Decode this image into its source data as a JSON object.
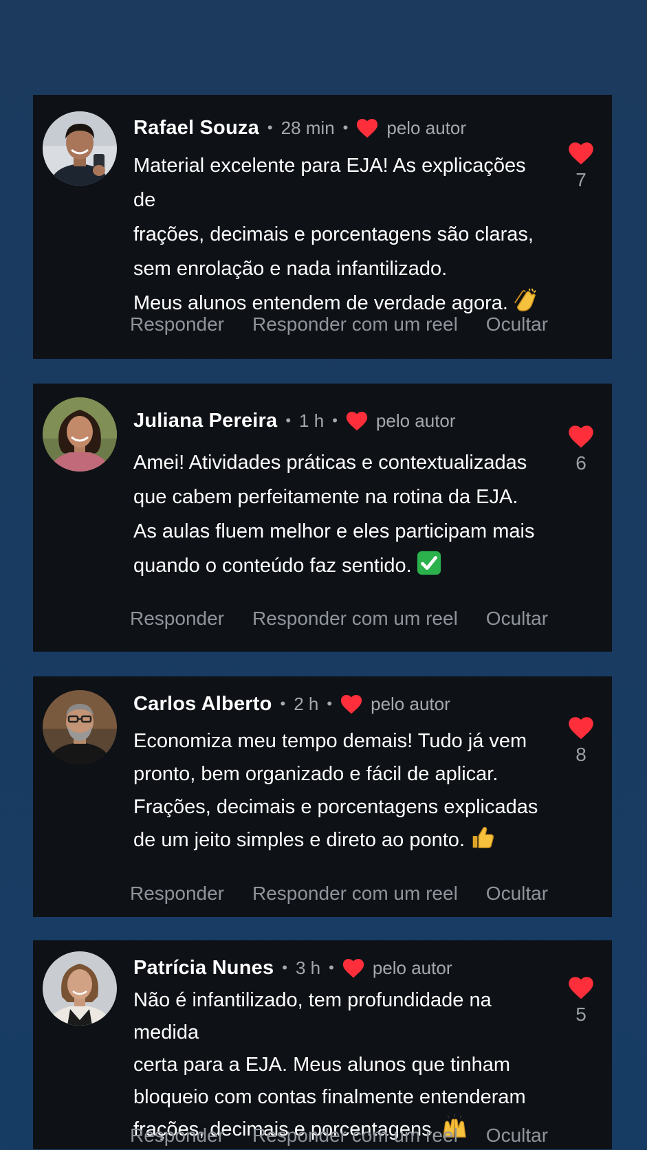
{
  "colors": {
    "background": "#173c64",
    "card": "#0e1116",
    "heart": "#ff2e3b",
    "name": "#ffffff",
    "meta": "#a5a9af",
    "action": "#8f949b"
  },
  "comments": [
    {
      "author": "Rafael Souza",
      "time": "28 min",
      "author_like_label": "pelo autor",
      "lines": [
        "Material excelente para EJA! As explicações de",
        "frações, decimais e porcentagens são claras,",
        "sem enrolação e nada infantilizado.",
        "Meus alunos entendem de verdade agora."
      ],
      "emoji": "clapping-hands",
      "likes": "7",
      "actions": [
        "Responder",
        "Responder com um reel",
        "Ocultar"
      ]
    },
    {
      "author": "Juliana Pereira",
      "time": "1 h",
      "author_like_label": "pelo autor",
      "lines": [
        "Amei! Atividades práticas e contextualizadas",
        "que cabem perfeitamente na rotina da EJA.",
        "As aulas fluem melhor e eles participam mais",
        "quando o conteúdo faz sentido."
      ],
      "emoji": "check-mark-button",
      "likes": "6",
      "actions": [
        "Responder",
        "Responder com um reel",
        "Ocultar"
      ]
    },
    {
      "author": "Carlos Alberto",
      "time": "2 h",
      "author_like_label": "pelo autor",
      "lines": [
        "Economiza meu tempo demais! Tudo já vem",
        "pronto, bem organizado e fácil de aplicar.",
        "Frações, decimais e porcentagens explicadas",
        "de um jeito simples e direto ao ponto."
      ],
      "emoji": "thumbs-up",
      "likes": "8",
      "actions": [
        "Responder",
        "Responder com um reel",
        "Ocultar"
      ]
    },
    {
      "author": "Patrícia Nunes",
      "time": "3 h",
      "author_like_label": "pelo autor",
      "lines": [
        "Não é infantilizado, tem profundidade na medida",
        "certa para a EJA. Meus alunos que tinham",
        "bloqueio com contas finalmente entenderam",
        "frações, decimais e porcentagens."
      ],
      "emoji": "raising-hands",
      "likes": "5",
      "actions": [
        "Responder",
        "Responder com um reel",
        "Ocultar"
      ]
    }
  ]
}
